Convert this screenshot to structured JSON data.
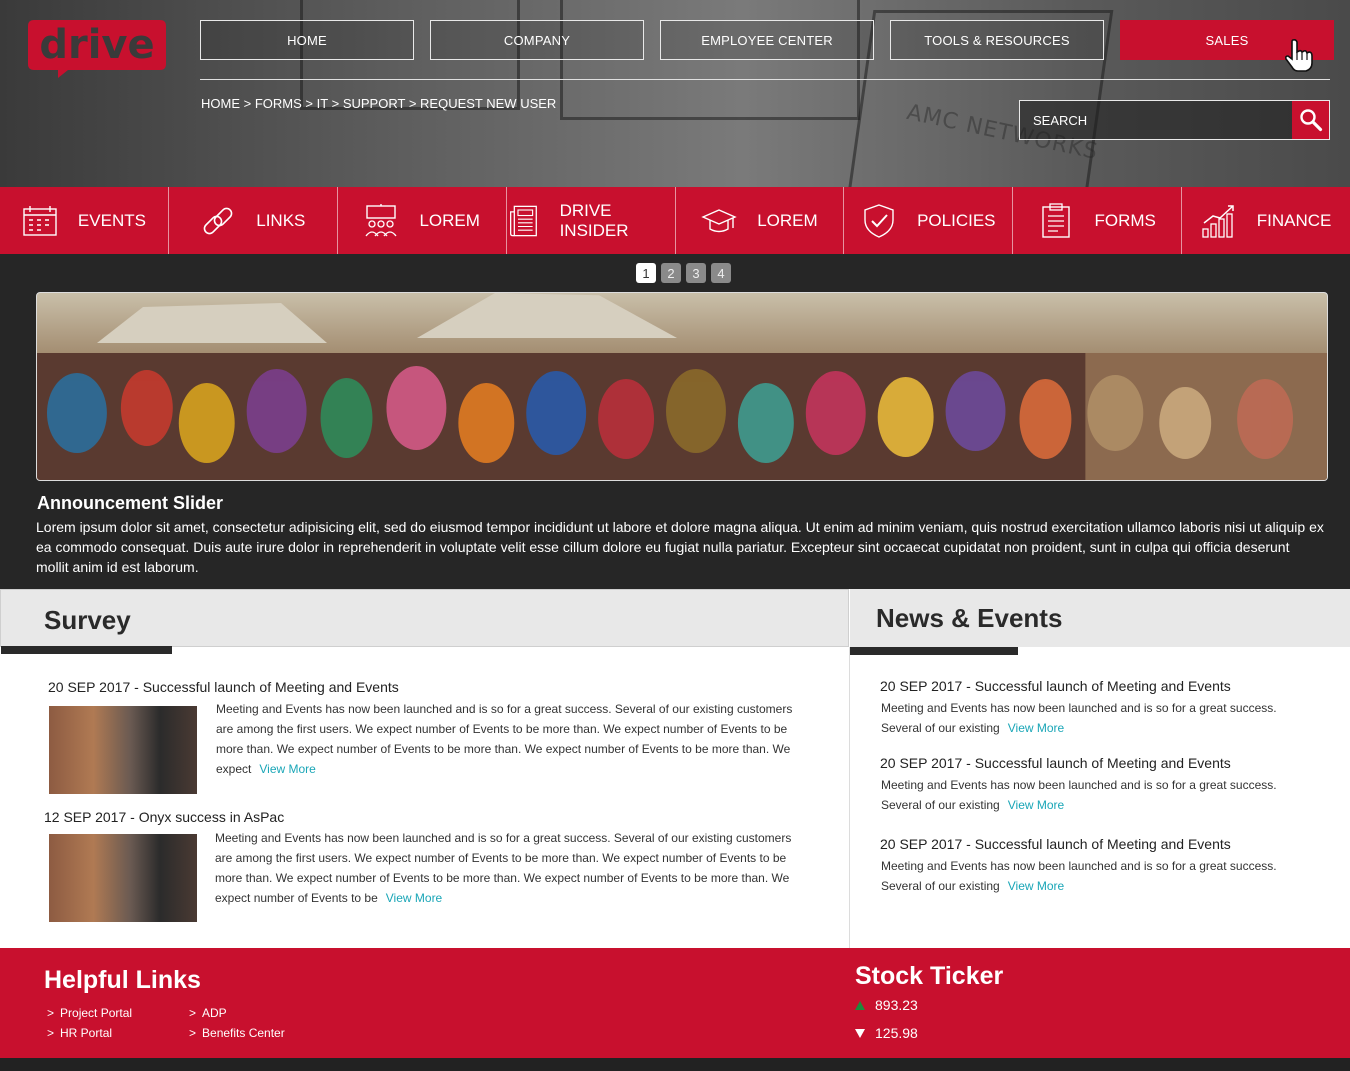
{
  "logo": {
    "text": "drive",
    "color": "#c8102e"
  },
  "nav": {
    "items": [
      {
        "label": "HOME"
      },
      {
        "label": "COMPANY"
      },
      {
        "label": "EMPLOYEE CENTER"
      },
      {
        "label": "TOOLS & RESOURCES"
      },
      {
        "label": "SALES",
        "active": true
      }
    ]
  },
  "breadcrumb": {
    "home": "HOME",
    "forms": "FORMS",
    "it": "IT",
    "support": "SUPPORT",
    "current": "REQUEST NEW USER",
    "separator": ">"
  },
  "search": {
    "placeholder": "SEARCH",
    "icon": "magnifier-icon"
  },
  "header_background": {
    "sign_text": "AMC NETWORKS"
  },
  "quick_links": [
    {
      "label": "EVENTS",
      "icon": "calendar-icon"
    },
    {
      "label": "LINKS",
      "icon": "chain-link-icon"
    },
    {
      "label": "LOREM",
      "icon": "people-presentation-icon"
    },
    {
      "label": "DRIVE INSIDER",
      "icon": "newspaper-icon"
    },
    {
      "label": "LOREM",
      "icon": "graduation-cap-icon"
    },
    {
      "label": "POLICIES",
      "icon": "shield-check-icon"
    },
    {
      "label": "FORMS",
      "icon": "clipboard-icon"
    },
    {
      "label": "FINANCE",
      "icon": "growth-chart-icon"
    }
  ],
  "slider": {
    "pages": [
      "1",
      "2",
      "3",
      "4"
    ],
    "active_page": "1",
    "title": "Announcement Slider",
    "text": "Lorem ipsum dolor sit amet, consectetur adipisicing elit, sed do eiusmod tempor incididunt ut labore et dolore magna aliqua. Ut enim ad minim veniam, quis nostrud exercitation ullamco laboris nisi ut aliquip ex ea commodo consequat. Duis aute irure dolor in reprehenderit in voluptate velit esse cillum dolore eu fugiat nulla pariatur. Excepteur sint occaecat cupidatat non proident, sunt in culpa qui officia deserunt mollit anim id est laborum."
  },
  "survey": {
    "title": "Survey",
    "items": [
      {
        "title": "20 SEP 2017  - Successful  launch of Meeting and Events",
        "line1": "Meeting and Events has now been launched and is so for a great success. Several of our existing customers",
        "line2": "are among the first users. We expect number of Events to be more than. We expect number of Events to be",
        "line3": "more than. We expect number of Events to be more than. We expect number of Events to be more than. We",
        "line4": "expect",
        "more": "View More"
      },
      {
        "title": "12 SEP 2017  - Onyx success in AsPac",
        "line1": "Meeting and Events has now been launched and is so for a great success. Several of our existing customers",
        "line2": "are among the first users. We expect number of Events to be more than. We expect number of Events to be",
        "line3": "more than. We expect number of Events to be more than. We expect number of Events to be more than. We",
        "line4": "expect number of Events to be",
        "more": "View More"
      }
    ]
  },
  "news": {
    "title": "News & Events",
    "items": [
      {
        "title": "20 SEP 2017  - Successful  launch of Meeting and Events",
        "line1": "Meeting and Events has now been launched and is so for a great success.",
        "line2": "Several of our existing",
        "more": "View More"
      },
      {
        "title": "20 SEP 2017  - Successful  launch of Meeting and Events",
        "line1": "Meeting and Events has now been launched and is so for a great success.",
        "line2": "Several of our existing",
        "more": "View More"
      },
      {
        "title": "20 SEP 2017  - Successful  launch of Meeting and Events",
        "line1": "Meeting and Events has now been launched and is so for a great success.",
        "line2": "Several of our existing",
        "more": "View More"
      }
    ]
  },
  "footer": {
    "helpful_links": {
      "title": "Helpful Links",
      "links": [
        "Project Portal",
        "HR Portal",
        "ADP",
        "Benefits Center"
      ],
      "bullet": ">"
    },
    "stock": {
      "title": "Stock Ticker",
      "up": {
        "value": "893.23",
        "color": "#1e8a3c",
        "icon": "triangle-up-icon"
      },
      "down": {
        "value": "125.98",
        "color": "#ffffff",
        "icon": "triangle-down-icon"
      }
    }
  },
  "colors": {
    "brand": "#c8102e",
    "dark": "#262626",
    "link": "#1aa6b7"
  }
}
